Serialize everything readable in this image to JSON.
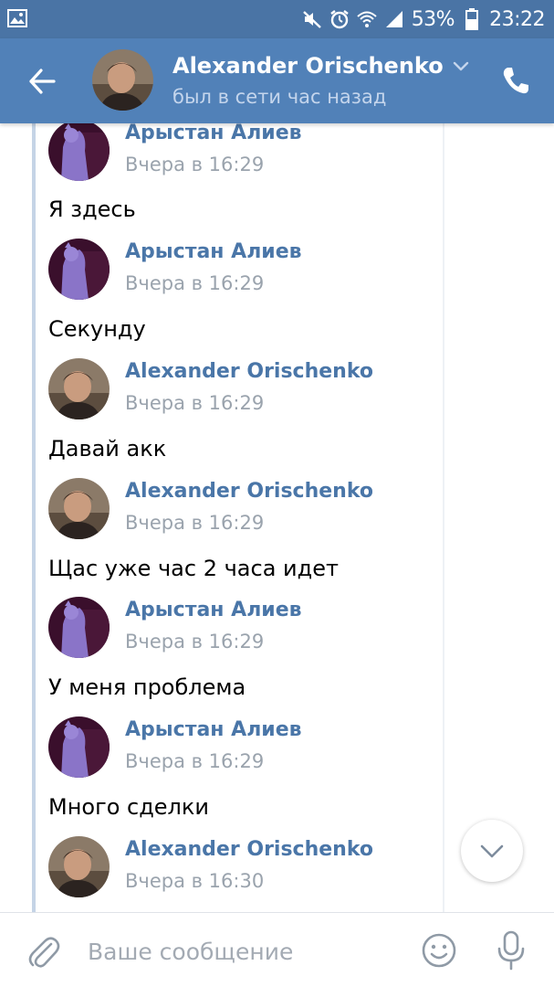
{
  "status_bar": {
    "gallery_icon": "gallery-icon",
    "mute_icon": "mute-icon",
    "alarm_icon": "alarm-icon",
    "wifi_icon": "wifi-icon",
    "signal_icon": "signal-icon",
    "battery_percent": "53%",
    "battery_icon": "battery-icon",
    "time": "23:22"
  },
  "header": {
    "contact_name": "Alexander Orischenko",
    "status": "был в сети час назад",
    "back_icon": "arrow-left-icon",
    "call_icon": "phone-icon",
    "chevron_icon": "chevron-down-icon"
  },
  "messages": [
    {
      "author": "Арыстан Алиев",
      "time": "Вчера в 16:29",
      "text": "Я здесь",
      "avatar": "arystan"
    },
    {
      "author": "Арыстан Алиев",
      "time": "Вчера в 16:29",
      "text": "Секунду",
      "avatar": "arystan"
    },
    {
      "author": "Alexander Orischenko",
      "time": "Вчера в 16:29",
      "text": "Давай акк",
      "avatar": "alexander"
    },
    {
      "author": "Alexander Orischenko",
      "time": "Вчера в 16:29",
      "text": "Щас уже час 2 часа идет",
      "avatar": "alexander"
    },
    {
      "author": "Арыстан Алиев",
      "time": "Вчера в 16:29",
      "text": "У меня проблема",
      "avatar": "arystan"
    },
    {
      "author": "Арыстан Алиев",
      "time": "Вчера в 16:29",
      "text": "Много сделки",
      "avatar": "arystan"
    },
    {
      "author": "Alexander Orischenko",
      "time": "Вчера в 16:30",
      "text": "",
      "avatar": "alexander"
    }
  ],
  "input": {
    "placeholder": "Ваше сообщение",
    "value": ""
  },
  "colors": {
    "status_bar": "#4a74a5",
    "header": "#5181b8",
    "author_link": "#4a76a8",
    "timestamp": "#9aa3ad"
  }
}
